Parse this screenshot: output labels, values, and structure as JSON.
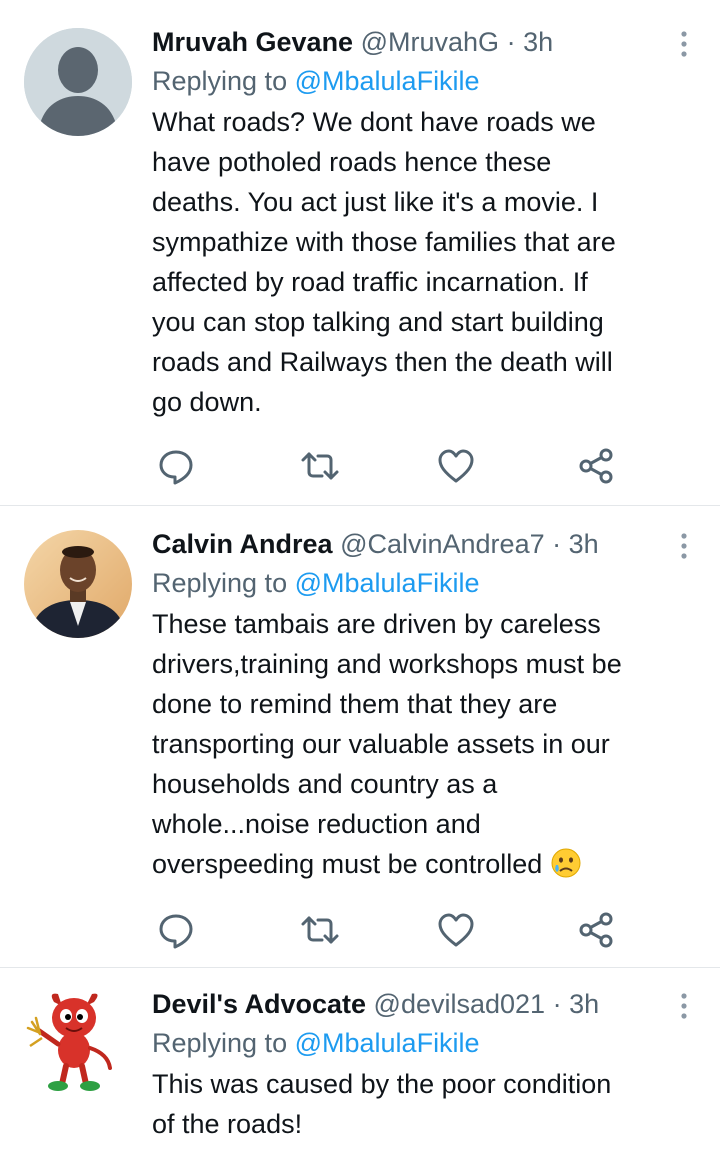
{
  "colors": {
    "text": "#0f1419",
    "muted": "#536471",
    "link": "#1d9bf0",
    "divider": "#e4e7ea"
  },
  "tweets": [
    {
      "name": "Mruvah Gevane",
      "handle": "@MruvahG",
      "sep": "·",
      "time": "3h",
      "reply_prefix": "Replying to",
      "reply_to": "@MbalulaFikile",
      "lines": [
        "What roads? We dont have roads we",
        "have potholed roads hence these",
        "deaths. You act  just like it's a movie. I",
        "sympathize with those families that are",
        "affected by road  traffic incarnation. If",
        "you can stop talking and start building",
        "roads and Railways then the death will",
        "go down."
      ],
      "avatar": "default-avatar-icon"
    },
    {
      "name": "Calvin Andrea",
      "handle": "@CalvinAndrea7",
      "sep": "·",
      "time": "3h",
      "reply_prefix": "Replying to",
      "reply_to": "@MbalulaFikile",
      "lines": [
        "These tambais are driven by careless",
        "drivers,training and workshops must be",
        "done to remind them that they are",
        "transporting our valuable assets in our",
        "households and country as a",
        "whole...noise reduction and",
        "overspeeding must be controlled"
      ],
      "emoji": "crying-face-emoji",
      "avatar": "profile-photo"
    },
    {
      "name": "Devil's Advocate",
      "handle": "@devilsad021",
      "sep": "·",
      "time": "3h",
      "reply_prefix": "Replying to",
      "reply_to": "@MbalulaFikile",
      "lines": [
        "This was caused by the poor condition",
        "of the roads!"
      ],
      "avatar": "devil-mascot-icon"
    }
  ],
  "action_icons": [
    "reply-icon",
    "retweet-icon",
    "like-icon",
    "share-icon"
  ]
}
